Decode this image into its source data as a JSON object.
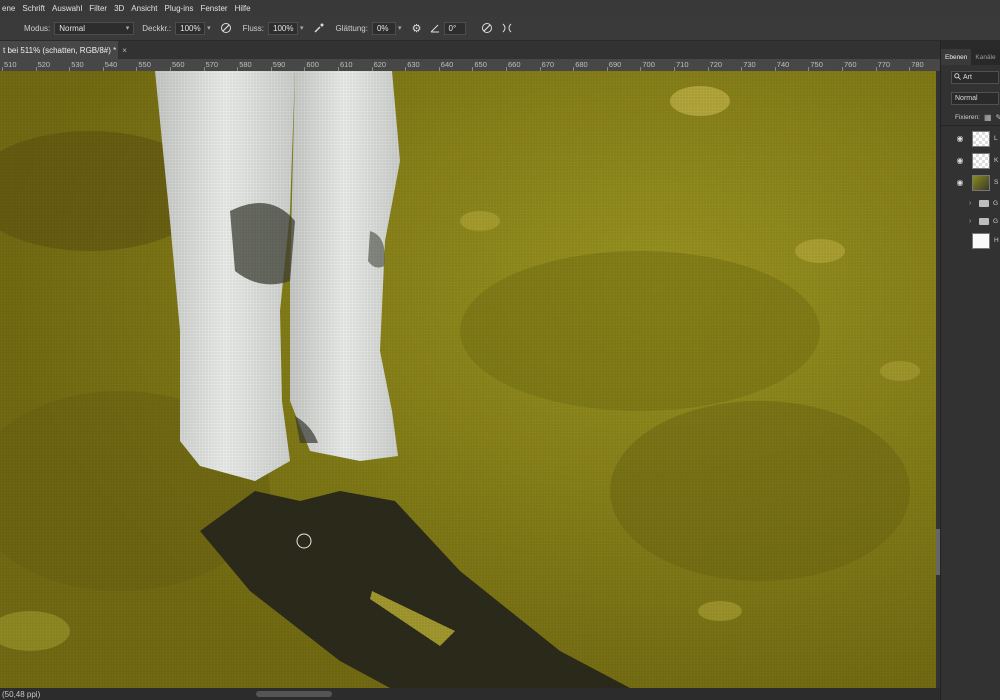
{
  "menu": [
    "ene",
    "Schrift",
    "Auswahl",
    "Filter",
    "3D",
    "Ansicht",
    "Plug-ins",
    "Fenster",
    "Hilfe"
  ],
  "options": {
    "modus_label": "Modus:",
    "modus_value": "Normal",
    "deckkr_label": "Deckkr.:",
    "deckkr_value": "100%",
    "fluss_label": "Fluss:",
    "fluss_value": "100%",
    "glaettung_label": "Glättung:",
    "glaettung_value": "0%",
    "angle_value": "0°"
  },
  "document_tab": {
    "title": "t bei 511% (schatten, RGB/8#) *",
    "close": "×"
  },
  "ruler": {
    "labels": [
      "510",
      "520",
      "530",
      "540",
      "550",
      "560",
      "570",
      "580",
      "590",
      "600",
      "610",
      "620",
      "630",
      "640",
      "650",
      "660",
      "670",
      "680",
      "690",
      "700",
      "710",
      "720",
      "730",
      "740",
      "750",
      "760",
      "770",
      "780"
    ]
  },
  "status": {
    "text": "(50,48 ppi)"
  },
  "layers_panel": {
    "tab_active": "Ebenen",
    "tab_inactive": "Kanäle",
    "filter_kind": "Art",
    "blend_mode": "Normal",
    "fix_label": "Fixieren:",
    "layers": [
      {
        "label": "L",
        "visible": true,
        "kind": "transparent"
      },
      {
        "label": "K",
        "visible": true,
        "kind": "transparent"
      },
      {
        "label": "S",
        "visible": true,
        "kind": "photo"
      },
      {
        "label": "G",
        "visible": false,
        "kind": "group"
      },
      {
        "label": "G",
        "visible": false,
        "kind": "group"
      },
      {
        "label": "H",
        "visible": false,
        "kind": "white"
      }
    ]
  },
  "colors": {
    "grass": "#8a8118",
    "fur": "#e4e6e4",
    "shadow": "#2c2b1c",
    "ui_bg": "#282828",
    "panel": "#323232"
  }
}
